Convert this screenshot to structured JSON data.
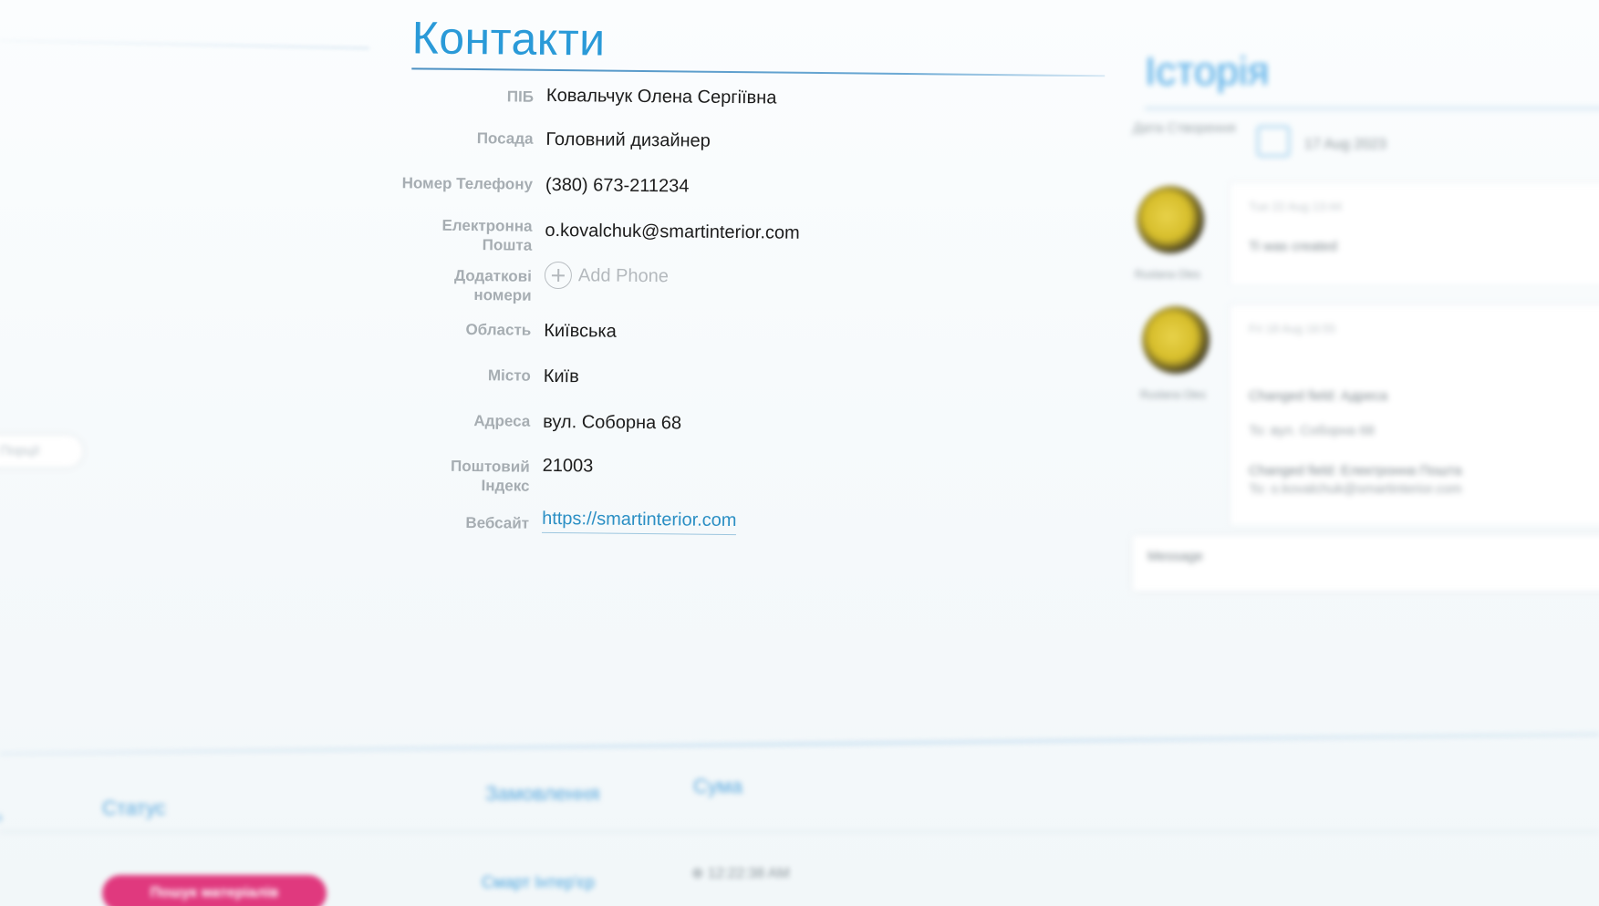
{
  "contacts": {
    "title": "Контакти",
    "fields": {
      "full_name": {
        "label": "ПІБ",
        "value": "Ковальчук Олена Сергіївна"
      },
      "position": {
        "label": "Посада",
        "value": "Головний дизайнер"
      },
      "phone": {
        "label": "Номер Телефону",
        "value": "(380) 673-211234"
      },
      "email": {
        "label_line1": "Електронна",
        "label_line2": "Пошта",
        "value": "o.kovalchuk@smartinterior.com"
      },
      "extra_numbers": {
        "label_line1": "Додаткові",
        "label_line2": "номери",
        "action": "Add Phone"
      },
      "region": {
        "label": "Область",
        "value": "Київська"
      },
      "city": {
        "label": "Місто",
        "value": "Київ"
      },
      "address": {
        "label": "Адреса",
        "value": "вул. Соборна 68"
      },
      "postal": {
        "label_line1": "Поштовий",
        "label_line2": "Індекс",
        "value": "21003"
      },
      "website": {
        "label": "Вебсайт",
        "value": "https://smartinterior.com"
      }
    }
  },
  "history": {
    "title": "Історія",
    "meta_label": "Дата Створення",
    "created_date": "17 Aug 2023",
    "entries": [
      {
        "author": "Ruslana Oles",
        "time": "Tue 22 Aug 13:44",
        "text": "Ti was created"
      },
      {
        "author": "Ruslana Oles",
        "time": "Fri 18 Aug 16:55",
        "changes": [
          {
            "line1": "Changed field: Адреса",
            "line2": "To: вул. Соборна 68"
          },
          {
            "line1": "Changed field: Електронна Пошта",
            "line2": "To: o.kovalchuk@smartinterior.com"
          }
        ]
      }
    ],
    "message_placeholder": "Message"
  },
  "left": {
    "pill_text": "Порції"
  },
  "table": {
    "headers": {
      "status": "Статус",
      "order": "Замовлення",
      "sum": "Сума"
    },
    "row": {
      "status": "Пошук матеріалів",
      "order": "Смарт Інтер'єр",
      "time": "⊕ 12:22:38 AM"
    }
  }
}
